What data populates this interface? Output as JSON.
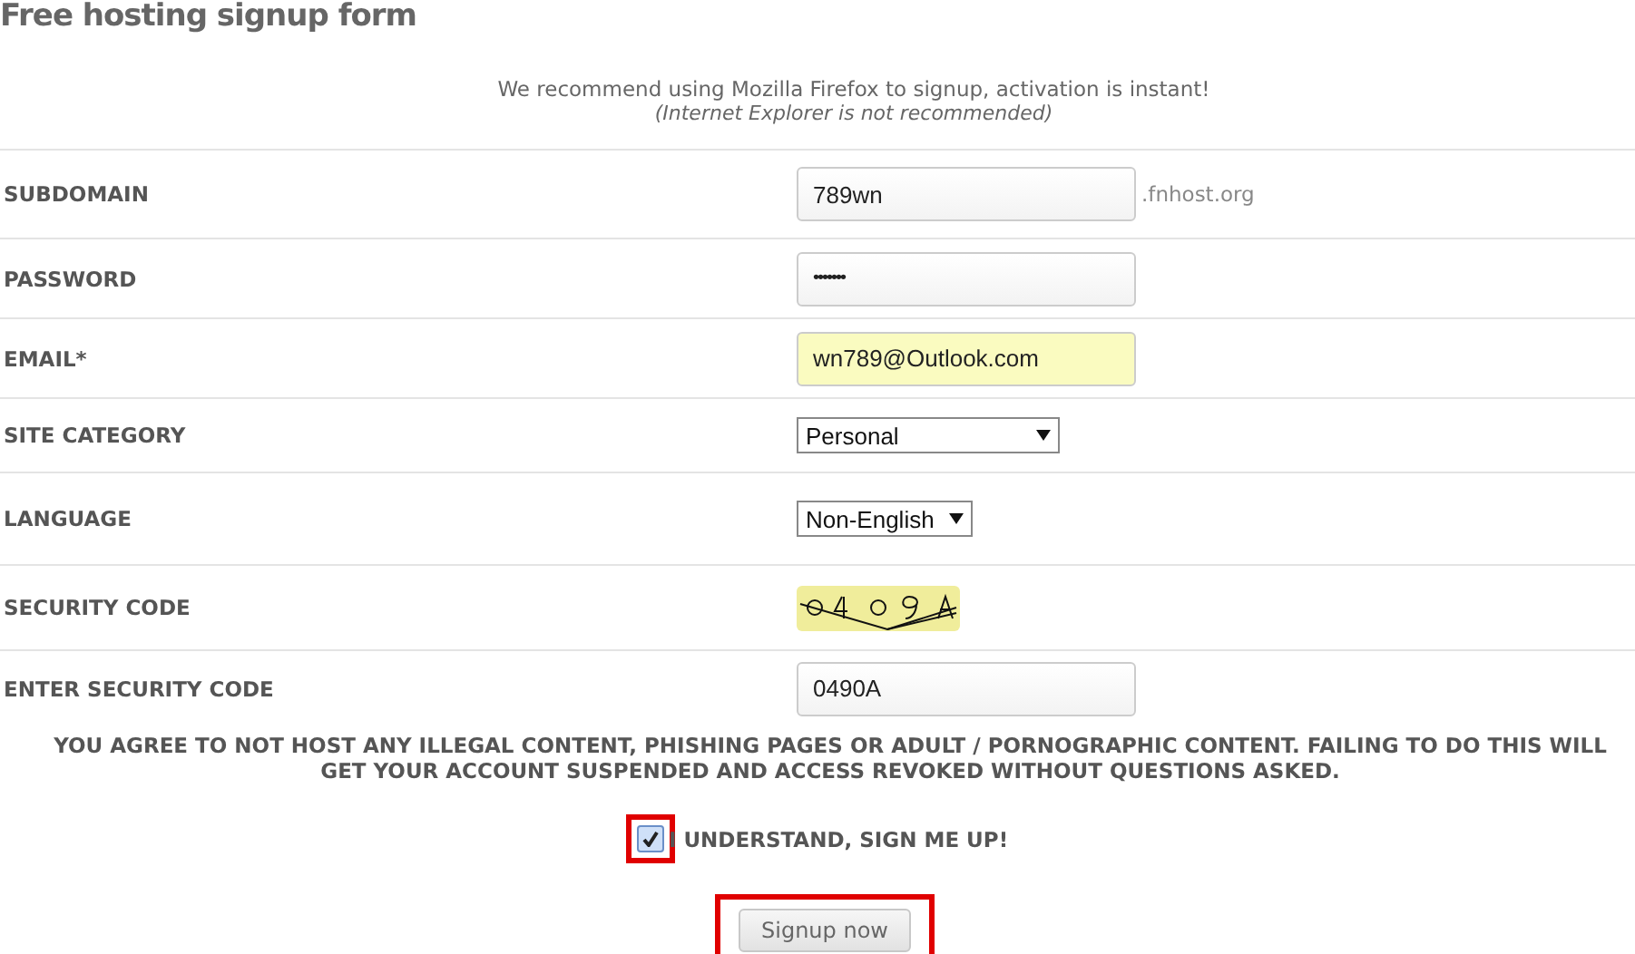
{
  "title": "Free hosting signup form",
  "notice": {
    "text": "We recommend using Mozilla Firefox to signup, activation is instant!",
    "note": "(Internet Explorer is not recommended)"
  },
  "fields": [
    {
      "kind": "text",
      "label": "SUBDOMAIN",
      "value": "789wn",
      "suffix": ".fnhost.org"
    },
    {
      "kind": "password",
      "label": "PASSWORD",
      "value": "•••••••"
    },
    {
      "kind": "autofill",
      "label": "EMAIL*",
      "value": "wn789@Outlook.com"
    },
    {
      "kind": "select",
      "label": "SITE CATEGORY",
      "value": "Personal"
    },
    {
      "kind": "select",
      "label": "LANGUAGE",
      "value": "Non-English"
    },
    {
      "kind": "captcha",
      "label": "SECURITY CODE"
    },
    {
      "kind": "text",
      "label": "ENTER SECURITY CODE",
      "value": "0490A"
    }
  ],
  "agreement": "YOU AGREE TO NOT HOST ANY ILLEGAL CONTENT, PHISHING PAGES OR ADULT / PORNOGRAPHIC CONTENT. FAILING TO DO THIS WILL GET YOUR ACCOUNT SUSPENDED AND ACCESS REVOKED WITHOUT QUESTIONS ASKED.",
  "consent": {
    "label": "I UNDERSTAND, SIGN ME UP!",
    "checked": true,
    "highlighted": true
  },
  "submit": {
    "label": "Signup now",
    "highlighted": true
  }
}
